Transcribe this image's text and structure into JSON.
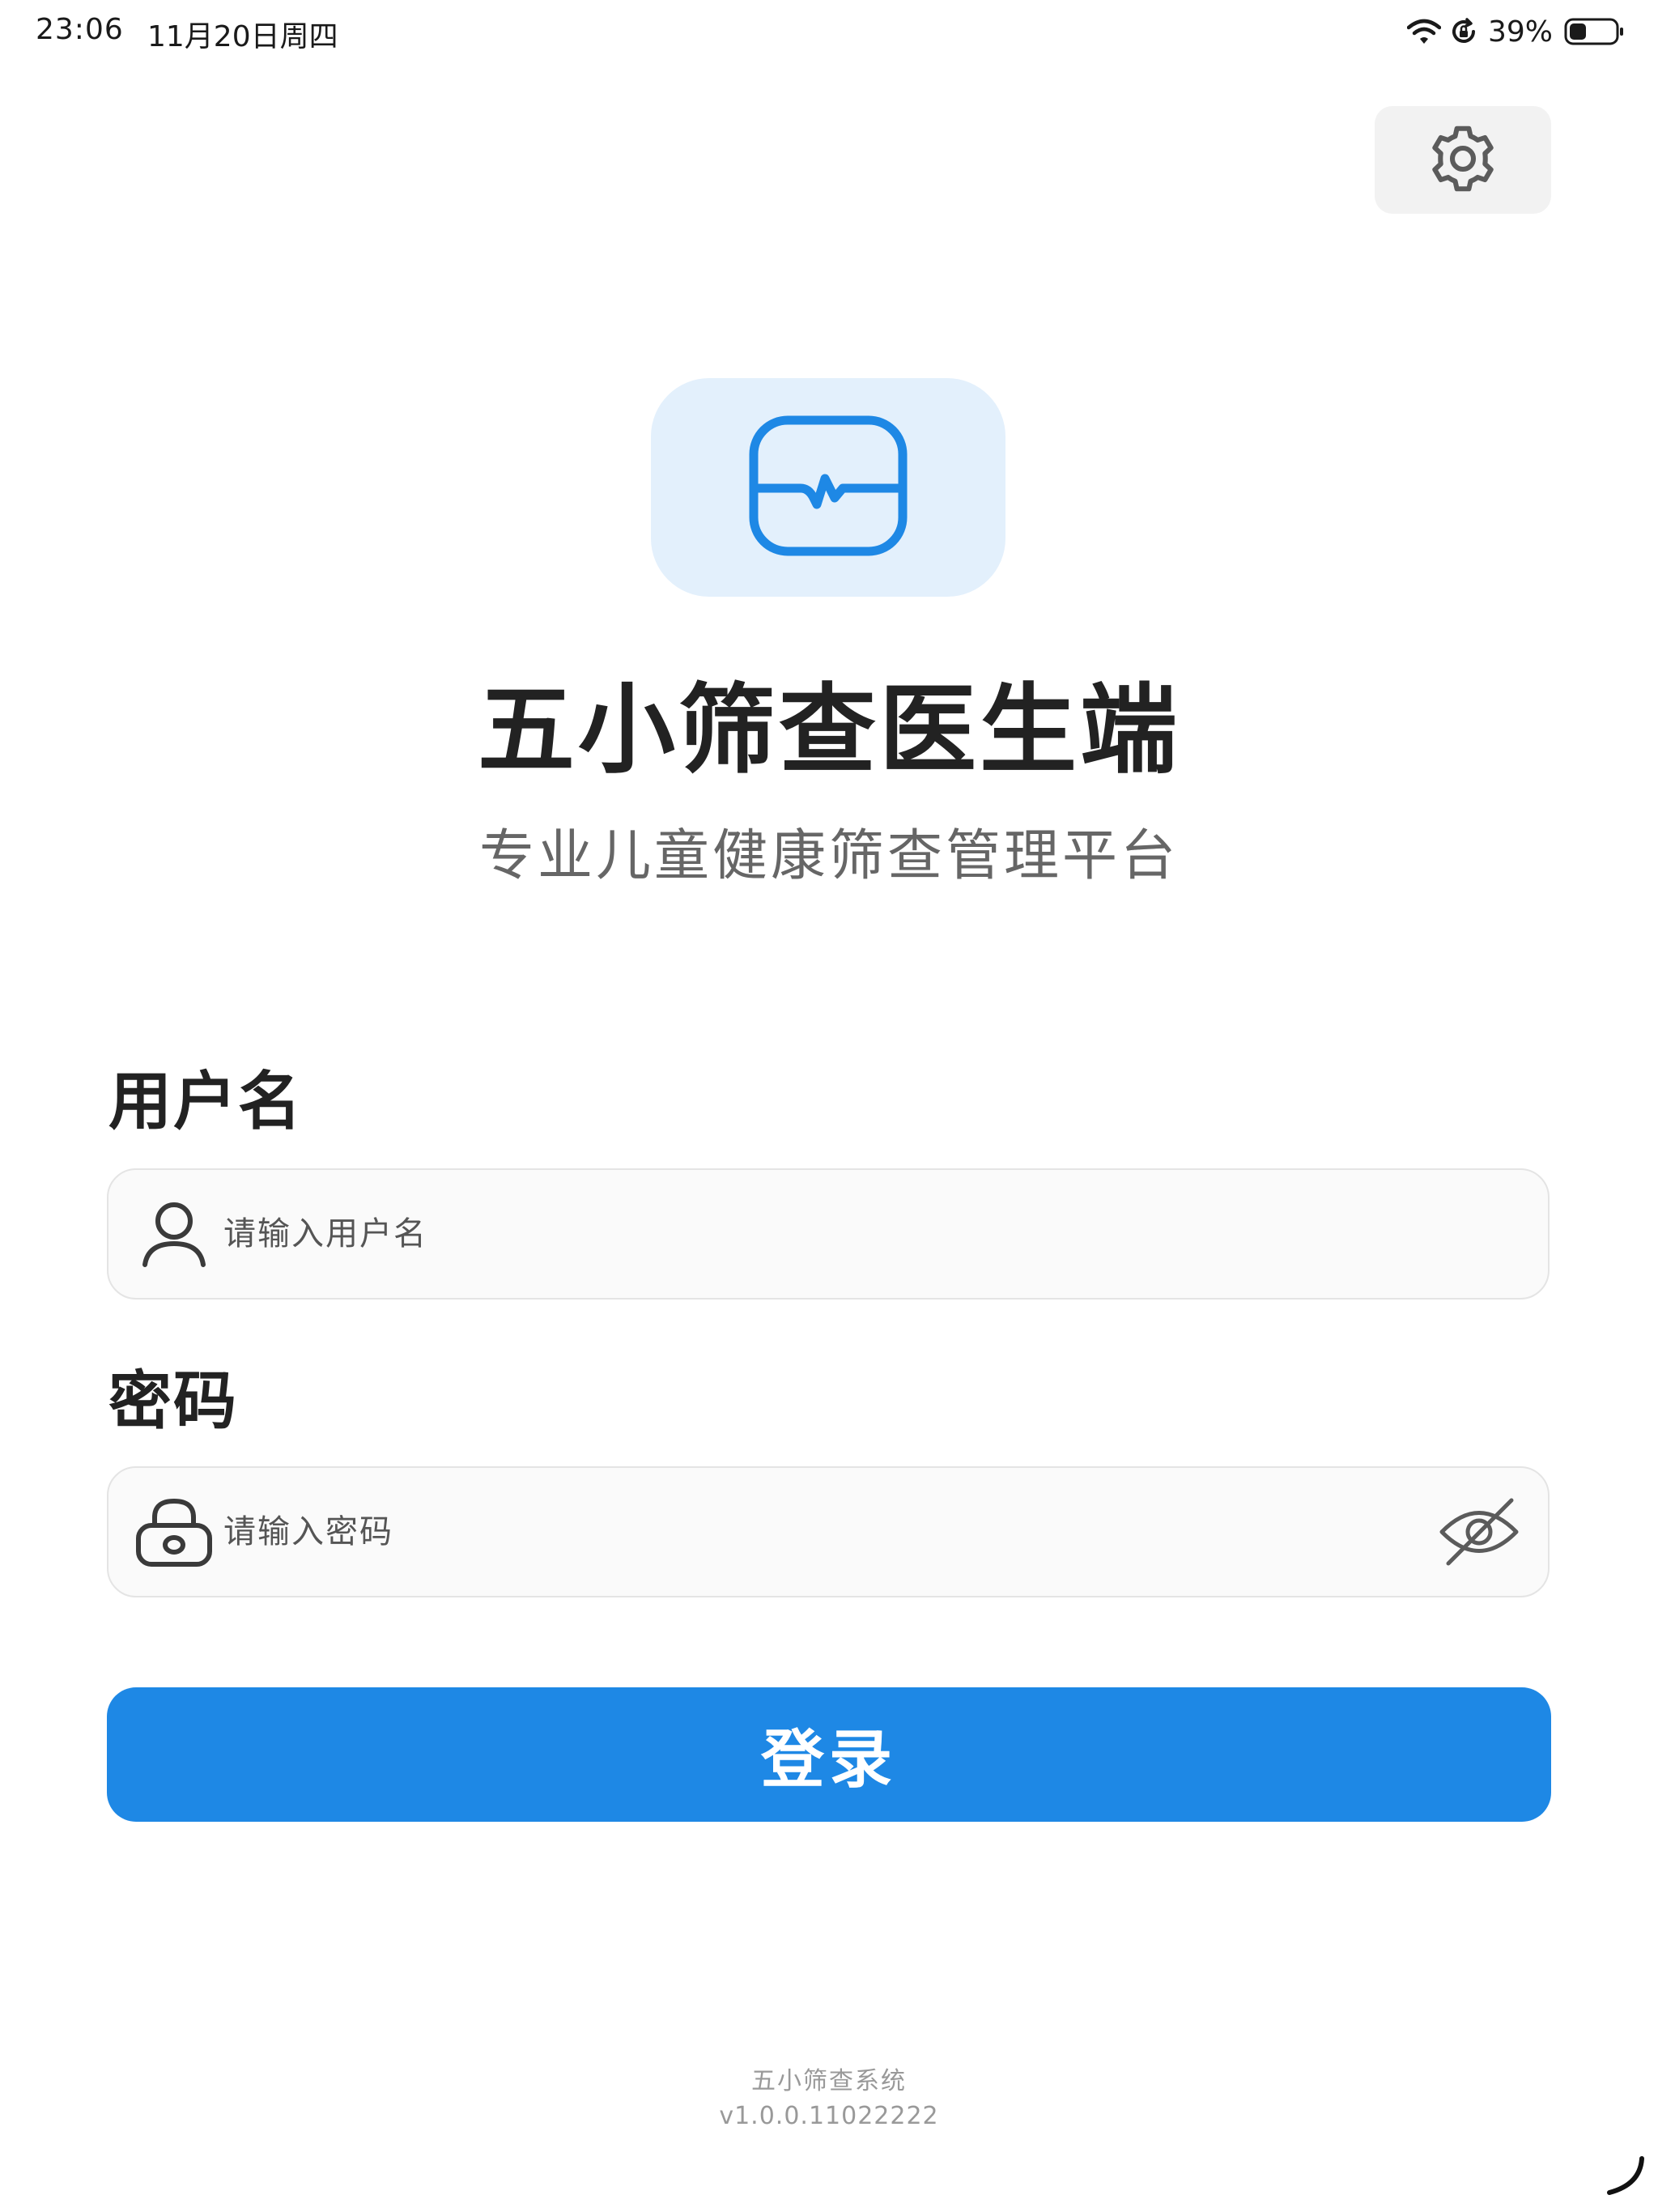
{
  "status_bar": {
    "time": "23:06",
    "date": "11月20日周四",
    "battery": "39%",
    "icons": [
      "wifi-icon",
      "rotation-lock-icon",
      "battery-icon"
    ]
  },
  "header": {
    "settings_icon": "gear-icon"
  },
  "brand": {
    "logo_icon": "heart-monitor-icon",
    "title": "五小筛查医生端",
    "subtitle": "专业儿童健康筛查管理平台"
  },
  "form": {
    "username": {
      "label": "用户名",
      "placeholder": "请输入用户名",
      "value": "",
      "icon": "user-icon"
    },
    "password": {
      "label": "密码",
      "placeholder": "请输入密码",
      "value": "",
      "icon": "lock-icon",
      "toggle_icon": "eye-slash-icon"
    },
    "login_label": "登录"
  },
  "footer": {
    "system_name": "五小筛查系统",
    "version": "v1.0.0.11022222"
  },
  "colors": {
    "primary": "#1e88e5",
    "logo_bg": "#e3f0fc",
    "input_bg": "#fafafa",
    "input_border": "#e4e4e4",
    "title_text": "#222222",
    "subtitle_text": "#666666",
    "footer_text": "#999999"
  }
}
